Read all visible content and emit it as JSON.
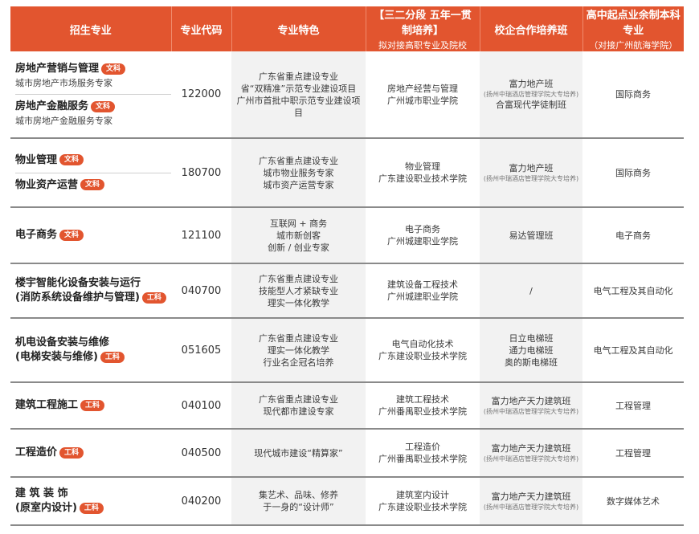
{
  "header": {
    "col_major": "招生专业",
    "col_code": "专业代码",
    "col_feature": "专业特色",
    "col_32": "【三二分段 五年一贯制培养】",
    "col_32_sub": "拟对接高职专业及院校",
    "col_coop": "校企合作培养班",
    "col_ben": "高中起点业余制本科专业",
    "col_ben_sub": "（对接广州航海学院）"
  },
  "rows": [
    {
      "majors": [
        {
          "name": "房地产营销与管理",
          "tag": "文科",
          "sub": "城市房地产市场服务专家"
        },
        {
          "name": "房地产金融服务",
          "tag": "文科",
          "sub": "城市房地产金融服务专家"
        }
      ],
      "code": "122000",
      "features": [
        "广东省重点建设专业",
        "省“双精准”示范专业建设项目",
        "广州市首批中职示范专业建设项目"
      ],
      "college": [
        "房地产经营与管理",
        "广州城市职业学院"
      ],
      "coop": [
        {
          "t": "富力地产班"
        },
        {
          "t": "(扬州中瑞酒店管理学院大专培养)",
          "small": true
        },
        {
          "t": "合富现代学徒制班"
        }
      ],
      "ben": "国际商务"
    },
    {
      "majors": [
        {
          "name": "物业管理",
          "tag": "文科",
          "sub": ""
        },
        {
          "name": "物业资产运营",
          "tag": "文科",
          "sub": ""
        }
      ],
      "code": "180700",
      "features": [
        "广东省重点建设专业",
        "城市物业服务专家",
        "城市资产运营专家"
      ],
      "college": [
        "物业管理",
        "广东建设职业技术学院"
      ],
      "coop": [
        {
          "t": "富力地产班"
        },
        {
          "t": "(扬州中瑞酒店管理学院大专培养)",
          "small": true
        }
      ],
      "ben": "国际商务"
    },
    {
      "majors": [
        {
          "name": "电子商务",
          "tag": "文科",
          "sub": ""
        }
      ],
      "code": "121100",
      "features": [
        "互联网 + 商务",
        "城市新创客",
        "创新 / 创业专家"
      ],
      "college": [
        "电子商务",
        "广州城建职业学院"
      ],
      "coop": [
        {
          "t": "易达管理班"
        }
      ],
      "ben": "电子商务"
    },
    {
      "majors": [
        {
          "name": "楼宇智能化设备安装与运行\n(消防系统设备维护与管理)",
          "tag": "工科",
          "sub": ""
        }
      ],
      "code": "040700",
      "features": [
        "广东省重点建设专业",
        "技能型人才紧缺专业",
        "理实一体化教学"
      ],
      "college": [
        "建筑设备工程技术",
        "广州城建职业学院"
      ],
      "coop": [
        {
          "t": "/"
        }
      ],
      "ben": "电气工程及其自动化"
    },
    {
      "majors": [
        {
          "name": "机电设备安装与维修\n(电梯安装与维修)",
          "tag": "工科",
          "sub": ""
        }
      ],
      "code": "051605",
      "features": [
        "广东省重点建设专业",
        "理实一体化教学",
        "行业名企冠名培养"
      ],
      "college": [
        "电气自动化技术",
        "广东建设职业技术学院"
      ],
      "coop": [
        {
          "t": "日立电梯班"
        },
        {
          "t": "通力电梯班"
        },
        {
          "t": "奥的斯电梯班"
        }
      ],
      "ben": "电气工程及其自动化"
    },
    {
      "majors": [
        {
          "name": "建筑工程施工",
          "tag": "工科",
          "sub": ""
        }
      ],
      "code": "040100",
      "features": [
        "广东省重点建设专业",
        "现代都市建设专家"
      ],
      "college": [
        "建筑工程技术",
        "广州番禺职业技术学院"
      ],
      "coop": [
        {
          "t": "富力地产天力建筑班"
        },
        {
          "t": "(扬州中瑞酒店管理学院大专培养)",
          "small": true
        }
      ],
      "ben": "工程管理"
    },
    {
      "majors": [
        {
          "name": "工程造价",
          "tag": "工科",
          "sub": ""
        }
      ],
      "code": "040500",
      "features": [
        "现代城市建设“精算家”"
      ],
      "college": [
        "工程造价",
        "广州番禺职业技术学院"
      ],
      "coop": [
        {
          "t": "富力地产天力建筑班"
        },
        {
          "t": "(扬州中瑞酒店管理学院大专培养)",
          "small": true
        }
      ],
      "ben": "工程管理"
    },
    {
      "majors": [
        {
          "name": "建 筑 装 饰\n(原室内设计)",
          "tag": "工科",
          "sub": ""
        }
      ],
      "code": "040200",
      "features": [
        "集艺术、品味、修养",
        "于一身的“设计师”"
      ],
      "college": [
        "建筑室内设计",
        "广东建设职业技术学院"
      ],
      "coop": [
        {
          "t": "富力地产天力建筑班"
        },
        {
          "t": "(扬州中瑞酒店管理学院大专培养)",
          "small": true
        }
      ],
      "ben": "数字媒体艺术"
    }
  ]
}
